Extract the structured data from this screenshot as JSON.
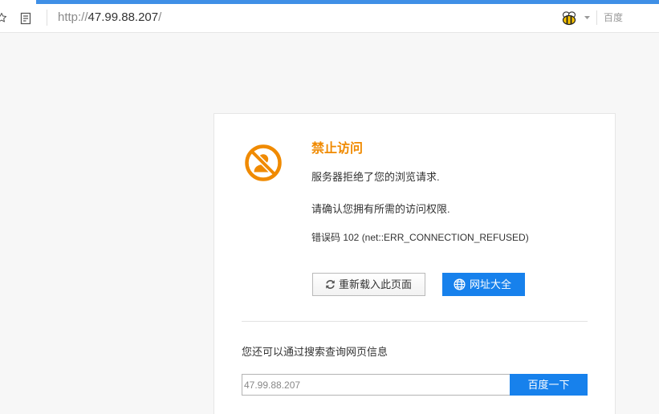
{
  "browser": {
    "toolbar": {
      "bookmark_icon": "star-icon",
      "reader_icon": "reader-mode-icon",
      "extension_icon": "bee-icon",
      "dropdown_icon": "dropdown-arrow-icon"
    },
    "address": {
      "scheme": "http://",
      "host": "47.99.88.207",
      "path": "/"
    },
    "search_engine_label": "百度",
    "accent_color": "#3f8fe6"
  },
  "error_page": {
    "icon": "forbidden-icon",
    "title": "禁止访问",
    "message": "服务器拒绝了您的浏览请求.",
    "hint": "请确认您拥有所需的访问权限.",
    "error_code": "错误码 102 (net::ERR_CONNECTION_REFUSED)",
    "accent_color": "#f08a00",
    "button_color": "#1781ec",
    "buttons": {
      "reload": {
        "label": "重新载入此页面",
        "icon": "refresh-icon"
      },
      "directory": {
        "label": "网址大全",
        "icon": "globe-icon"
      }
    },
    "search": {
      "prompt": "您还可以通过搜索查询网页信息",
      "query": "47.99.88.207",
      "button_label": "百度一下"
    }
  }
}
